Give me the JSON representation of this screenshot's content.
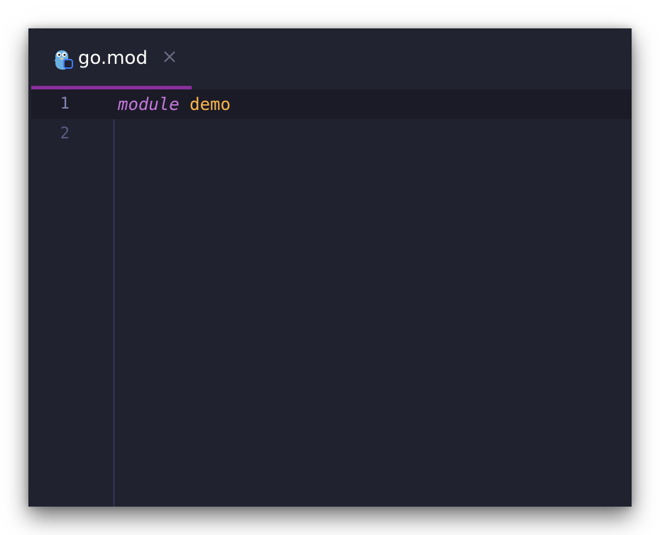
{
  "tab": {
    "icon": "go-gopher-icon",
    "label": "go.mod",
    "close_icon": "close-icon"
  },
  "colors": {
    "editor_bg": "#21222f",
    "active_tab_indicator": "#8a2f9c",
    "keyword": "#c678dd",
    "identifier": "#f9b54a",
    "line_number": "#5b5e84"
  },
  "editor": {
    "lines": [
      {
        "number": "1",
        "keyword": "module",
        "identifier": "demo"
      },
      {
        "number": "2",
        "keyword": "",
        "identifier": ""
      }
    ]
  }
}
